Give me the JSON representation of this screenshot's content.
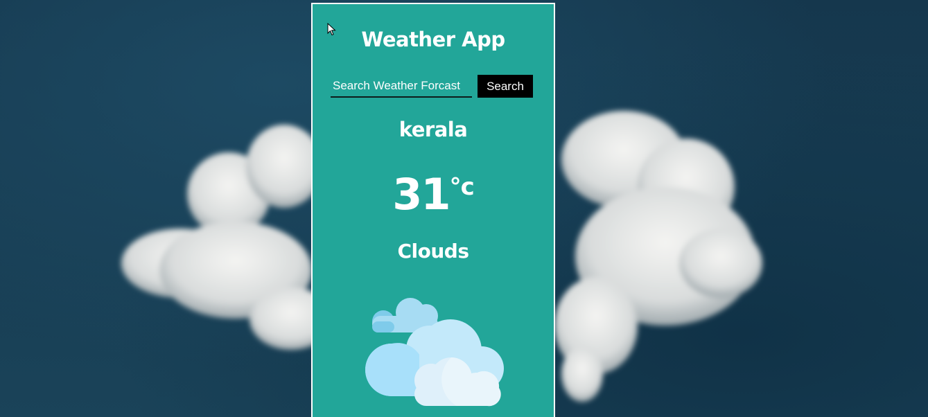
{
  "app": {
    "title": "Weather App"
  },
  "search": {
    "placeholder": "Search Weather Forcast",
    "value": "",
    "button_label": "Search"
  },
  "weather": {
    "city": "kerala",
    "temperature": "31",
    "unit": "°c",
    "condition": "Clouds",
    "icon": "clouds-icon"
  },
  "colors": {
    "card_background": "#22a699",
    "card_border": "#ffffff",
    "search_button_background": "#000000",
    "text": "#ffffff",
    "page_background": "#15384e"
  }
}
